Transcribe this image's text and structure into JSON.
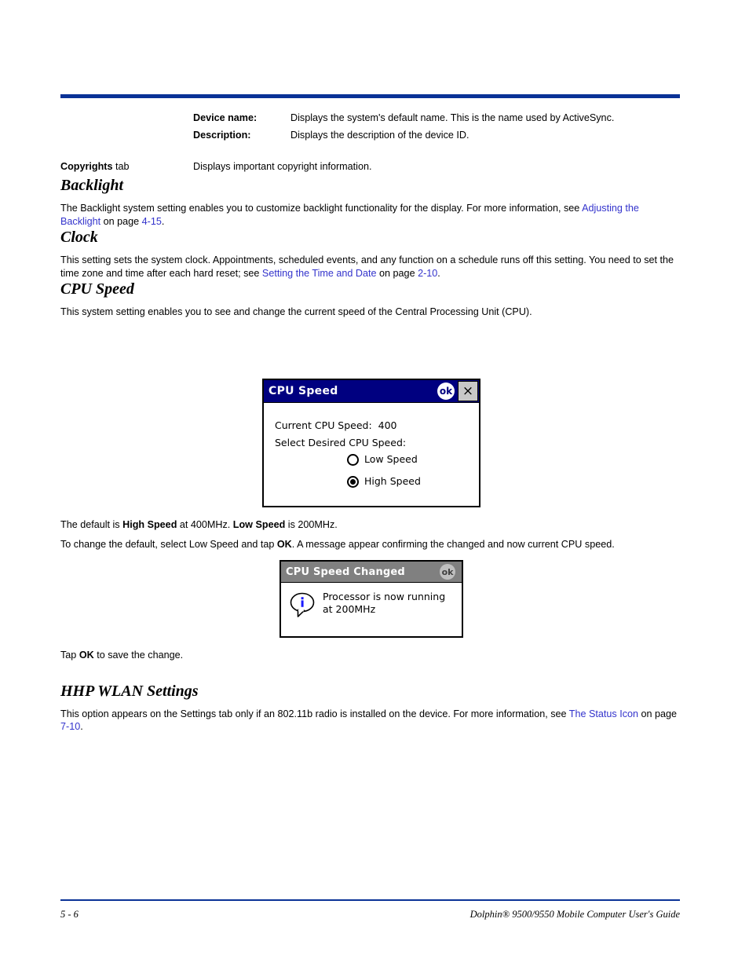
{
  "page": {
    "rule_color": "#0a3296",
    "link_color": "#3333cc"
  },
  "definitions": [
    {
      "term": "Device name:",
      "desc": "Displays the system's default name. This is the name used by ActiveSync."
    },
    {
      "term": "Description:",
      "desc": "Displays the description of the device ID."
    }
  ],
  "copyrights_row": {
    "term_bold": "Copyrights",
    "term_regular": " tab",
    "desc": "Displays important copyright information."
  },
  "sections": {
    "backlight": {
      "heading": "Backlight",
      "body_pre": "The Backlight system setting enables you to customize backlight functionality for the display. For more information, see ",
      "link1": "Adjusting the Backlight",
      "body_mid": " on page ",
      "link2": "4-15",
      "body_end": "."
    },
    "clock": {
      "heading": "Clock",
      "body_pre": "This setting sets the system clock. Appointments, scheduled events, and any function on a schedule runs off this setting. You need to set the time zone and time after each hard reset; see ",
      "link1": "Setting the Time and Date",
      "body_mid": " on page ",
      "link2": "2-10",
      "body_end": "."
    },
    "cpu_speed": {
      "heading": "CPU Speed",
      "intro": "This system setting enables you to see and change the current speed of the Central Processing Unit (CPU).",
      "default_pre": "The default is ",
      "default_bold1": "High Speed",
      "default_mid": " at 400MHz. ",
      "default_bold2": "Low Speed",
      "default_end": " is 200MHz.",
      "change_pre": "To change the default, select Low Speed and tap ",
      "change_bold": "OK",
      "change_end": ". A message appear confirming the changed and now current CPU speed.",
      "save_pre": "Tap ",
      "save_bold": "OK",
      "save_end": " to save the change."
    },
    "hhp_wlan": {
      "heading": "HHP WLAN Settings",
      "body_pre": "This option  appears on the Settings tab only if an 802.11b radio is installed on the device. For more information, see ",
      "link1": "The Status Icon",
      "body_mid": " on page ",
      "link2": "7-10",
      "body_end": "."
    }
  },
  "dialog_cpu_speed": {
    "title": "CPU Speed",
    "ok_label": "ok",
    "close_label": "×",
    "current_line": "Current CPU Speed:  400",
    "select_line": "Select Desired CPU Speed:",
    "options": [
      {
        "label": "Low Speed",
        "selected": false
      },
      {
        "label": "High Speed",
        "selected": true
      }
    ],
    "titlebar_color": "#000080"
  },
  "dialog_cpu_speed_changed": {
    "title": "CPU Speed Changed",
    "ok_label": "ok",
    "message": "Processor is now running\nat 200MHz",
    "titlebar_color": "#808080"
  },
  "footer": {
    "page_number": "5 - 6",
    "guide_title": "Dolphin® 9500/9550 Mobile Computer User's Guide"
  }
}
